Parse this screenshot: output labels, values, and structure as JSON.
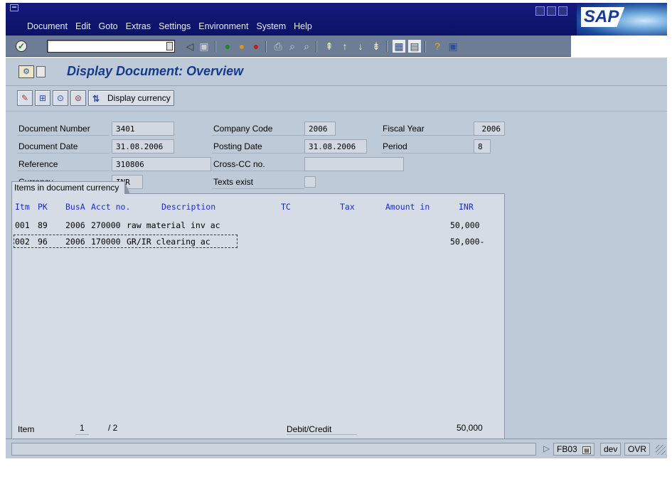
{
  "menu": {
    "items": [
      "Document",
      "Edit",
      "Goto",
      "Extras",
      "Settings",
      "Environment",
      "System",
      "Help"
    ]
  },
  "logo": {
    "text": "SAP"
  },
  "toolbar": {
    "command_field": "",
    "icons": [
      "check-icon",
      "back-arrow-icon",
      "save-icon",
      "back-icon",
      "exit-icon",
      "cancel-icon",
      "print-icon",
      "find-icon",
      "find-next-icon",
      "first-page-icon",
      "previous-page-icon",
      "next-page-icon",
      "last-page-icon",
      "create-session-icon",
      "shortcut-icon",
      "help-icon",
      "layout-menu-icon"
    ]
  },
  "page": {
    "title": "Display Document: Overview"
  },
  "appbar": {
    "display_currency_label": "Display currency"
  },
  "header": {
    "document_number_label": "Document Number",
    "document_number": "3401",
    "company_code_label": "Company Code",
    "company_code": "2006",
    "fiscal_year_label": "Fiscal Year",
    "fiscal_year": "2006",
    "document_date_label": "Document Date",
    "document_date": "31.08.2006",
    "posting_date_label": "Posting Date",
    "posting_date": "31.08.2006",
    "period_label": "Period",
    "period": "8",
    "reference_label": "Reference",
    "reference": "310806",
    "cross_cc_label": "Cross-CC no.",
    "cross_cc": "",
    "currency_label": "Currency",
    "currency": "INR",
    "texts_exist_label": "Texts exist"
  },
  "items": {
    "tab_label": "Items in document currency",
    "columns": {
      "itm": "Itm",
      "pk": "PK",
      "busa": "BusA",
      "acct": "Acct no.",
      "description": "Description",
      "tc": "TC",
      "tax": "Tax",
      "amount": "Amount in",
      "currency": "INR"
    },
    "rows": [
      {
        "itm": "001",
        "pk": "89",
        "busa": "2006",
        "acct": "270000",
        "description": "raw material inv ac",
        "amount": "50,000"
      },
      {
        "itm": "002",
        "pk": "96",
        "busa": "2006",
        "acct": "170000",
        "description": "GR/IR clearing ac",
        "amount": "50,000-"
      }
    ]
  },
  "footer": {
    "item_label": "Item",
    "item_current": "1",
    "item_total": "/ 2",
    "debit_credit_label": "Debit/Credit",
    "total": "50,000"
  },
  "status": {
    "transaction": "FB03",
    "system": "dev",
    "mode": "OVR"
  }
}
